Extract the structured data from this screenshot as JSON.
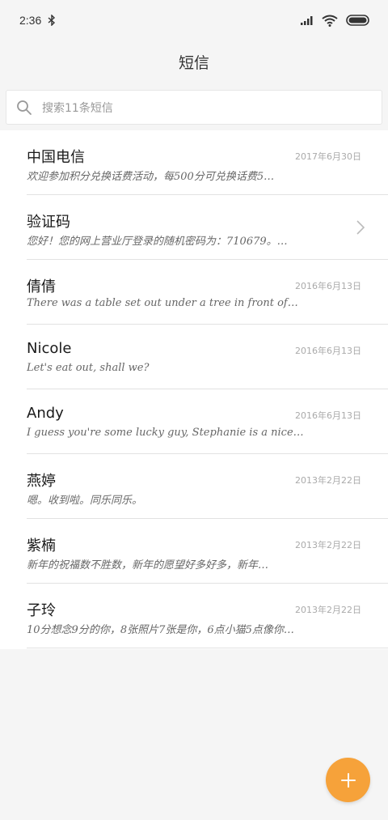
{
  "status_bar": {
    "time": "2:36",
    "icons": [
      "bluetooth-icon",
      "signal-icon",
      "wifi-icon",
      "battery-icon"
    ]
  },
  "header": {
    "title": "短信"
  },
  "search": {
    "placeholder": "搜索11条短信"
  },
  "messages": [
    {
      "name": "中国电信",
      "date": "2017年6月30日",
      "preview": "欢迎参加积分兑换话费活动，每500分可兑换话费5…"
    },
    {
      "name": "验证码",
      "date": "",
      "preview": "您好！您的网上营业厅登录的随机密码为：710679。…"
    },
    {
      "name": "倩倩",
      "date": "2016年6月13日",
      "preview": "There was a table set out under a tree in front of…"
    },
    {
      "name": "Nicole",
      "date": "2016年6月13日",
      "preview": "Let's eat out, shall we?"
    },
    {
      "name": "Andy",
      "date": "2016年6月13日",
      "preview": "I guess you're some lucky guy, Stephanie is a nice…"
    },
    {
      "name": "燕婷",
      "date": "2013年2月22日",
      "preview": "嗯。收到啦。同乐同乐。"
    },
    {
      "name": "紫楠",
      "date": "2013年2月22日",
      "preview": "新年的祝福数不胜数，新年的愿望好多好多，新年…"
    },
    {
      "name": "子玲",
      "date": "2013年2月22日",
      "preview": "10分想念9分的你，8张照片7张是你，6点小猫5点像你…"
    }
  ],
  "colors": {
    "accent": "#f6a23a",
    "background": "#f5f5f5"
  },
  "fab": {
    "icon": "plus-icon"
  }
}
